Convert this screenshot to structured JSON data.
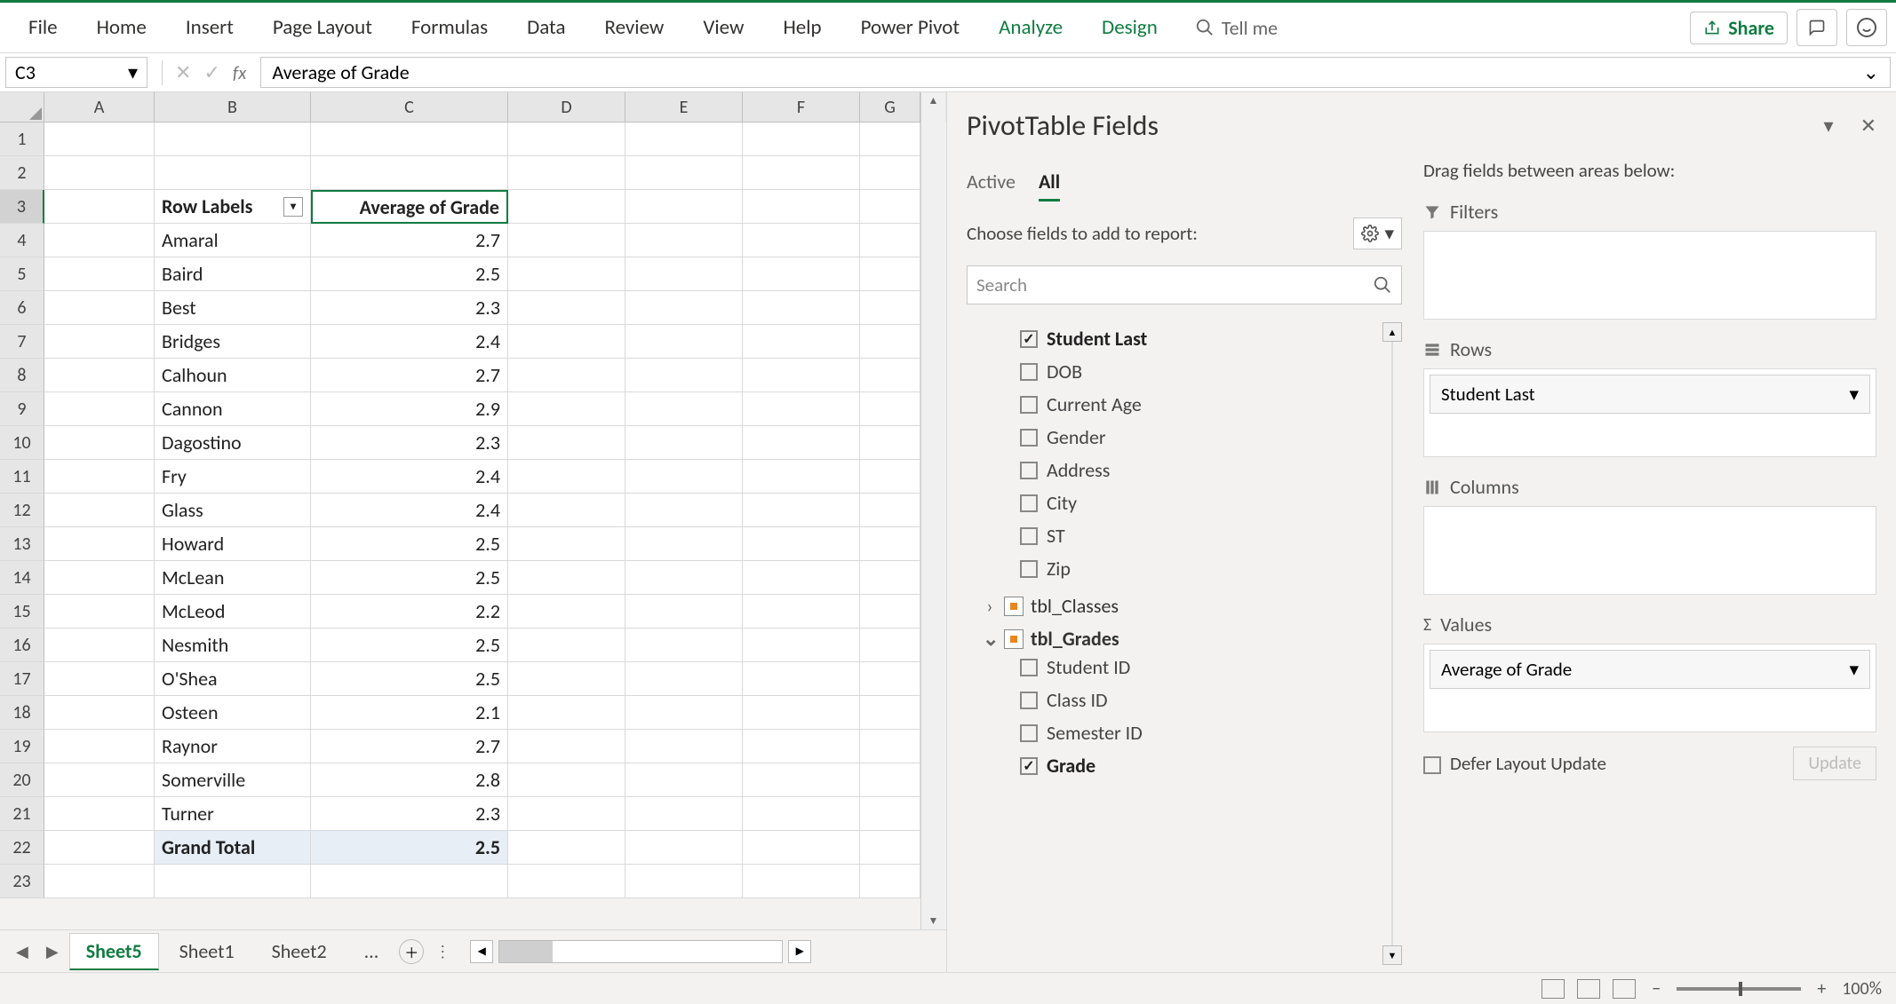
{
  "ribbon": {
    "tabs": [
      "File",
      "Home",
      "Insert",
      "Page Layout",
      "Formulas",
      "Data",
      "Review",
      "View",
      "Help",
      "Power Pivot",
      "Analyze",
      "Design"
    ],
    "green_tabs": [
      "Analyze",
      "Design"
    ],
    "tellme": "Tell me",
    "share": "Share"
  },
  "formula_bar": {
    "namebox": "C3",
    "formula": "Average of Grade"
  },
  "columns": [
    "A",
    "B",
    "C",
    "D",
    "E",
    "F",
    "G"
  ],
  "pivot": {
    "header_rowlabels": "Row Labels",
    "header_value": "Average of Grade",
    "rows": [
      {
        "label": "Amaral",
        "value": "2.7"
      },
      {
        "label": "Baird",
        "value": "2.5"
      },
      {
        "label": "Best",
        "value": "2.3"
      },
      {
        "label": "Bridges",
        "value": "2.4"
      },
      {
        "label": "Calhoun",
        "value": "2.7"
      },
      {
        "label": "Cannon",
        "value": "2.9"
      },
      {
        "label": "Dagostino",
        "value": "2.3"
      },
      {
        "label": "Fry",
        "value": "2.4"
      },
      {
        "label": "Glass",
        "value": "2.4"
      },
      {
        "label": "Howard",
        "value": "2.5"
      },
      {
        "label": "McLean",
        "value": "2.5"
      },
      {
        "label": "McLeod",
        "value": "2.2"
      },
      {
        "label": "Nesmith",
        "value": "2.5"
      },
      {
        "label": "O'Shea",
        "value": "2.5"
      },
      {
        "label": "Osteen",
        "value": "2.1"
      },
      {
        "label": "Raynor",
        "value": "2.7"
      },
      {
        "label": "Somerville",
        "value": "2.8"
      },
      {
        "label": "Turner",
        "value": "2.3"
      }
    ],
    "grand_total_label": "Grand Total",
    "grand_total_value": "2.5"
  },
  "sheets": {
    "active": "Sheet5",
    "list": [
      "Sheet5",
      "Sheet1",
      "Sheet2"
    ],
    "more": "..."
  },
  "pane": {
    "title": "PivotTable Fields",
    "tabs": {
      "active": "Active",
      "all": "All"
    },
    "choose": "Choose fields to add to report:",
    "search_placeholder": "Search",
    "drag": "Drag fields between areas below:",
    "fields_group1": [
      {
        "label": "Student Last",
        "checked": true,
        "bold": true
      },
      {
        "label": "DOB",
        "checked": false
      },
      {
        "label": "Current Age",
        "checked": false
      },
      {
        "label": "Gender",
        "checked": false
      },
      {
        "label": "Address",
        "checked": false
      },
      {
        "label": "City",
        "checked": false
      },
      {
        "label": "ST",
        "checked": false
      },
      {
        "label": "Zip",
        "checked": false
      }
    ],
    "table_collapsed": "tbl_Classes",
    "table_expanded": "tbl_Grades",
    "fields_group2": [
      {
        "label": "Student ID",
        "checked": false
      },
      {
        "label": "Class ID",
        "checked": false
      },
      {
        "label": "Semester ID",
        "checked": false
      },
      {
        "label": "Grade",
        "checked": true,
        "bold": true
      }
    ],
    "areas": {
      "filters": "Filters",
      "rows": "Rows",
      "rows_item": "Student Last",
      "columns": "Columns",
      "values": "Values",
      "values_item": "Average of Grade"
    },
    "defer": "Defer Layout Update",
    "update": "Update"
  },
  "status": {
    "zoom": "100%"
  }
}
